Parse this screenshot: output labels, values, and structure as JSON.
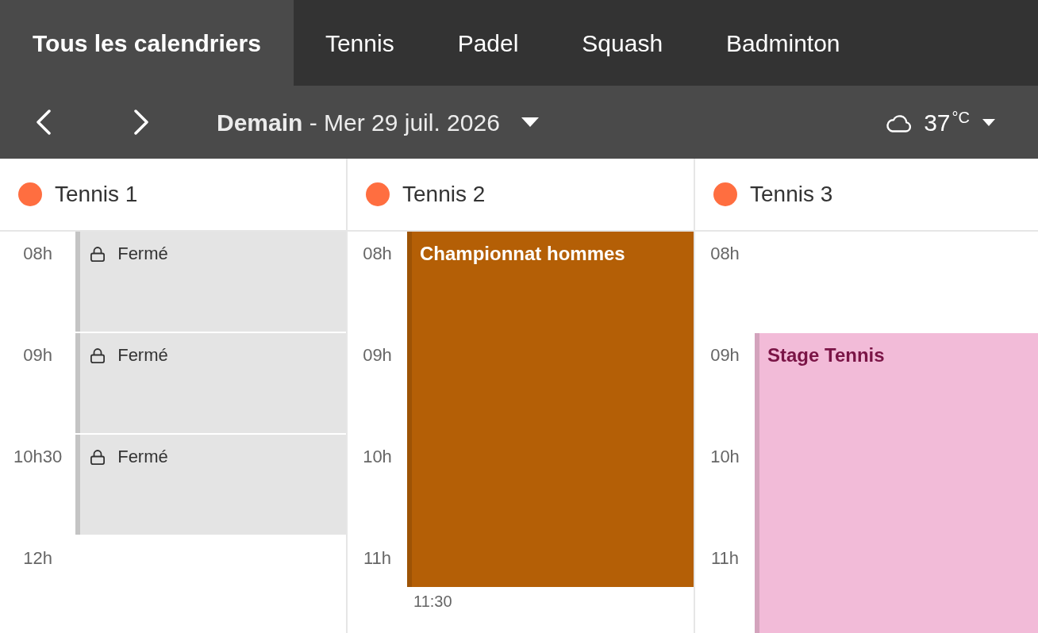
{
  "tabs": [
    {
      "label": "Tous les calendriers",
      "selected": true
    },
    {
      "label": "Tennis",
      "selected": false
    },
    {
      "label": "Padel",
      "selected": false
    },
    {
      "label": "Squash",
      "selected": false
    },
    {
      "label": "Badminton",
      "selected": false
    }
  ],
  "toolbar": {
    "date": "**Demain** - Mer 29 juil. 2026",
    "weather": {
      "temperature": "37$^{°C}$"
    }
  },
  "columns": [
    {
      "name": "Tennis 1",
      "color": "#ff6e40",
      "slots": [
        {
          "time": "08h",
          "kind": "closed",
          "label": "Fermé"
        },
        {
          "time": "09h",
          "kind": "closed",
          "label": "Fermé"
        },
        {
          "time": "10h30",
          "kind": "closed",
          "label": "Fermé"
        },
        {
          "time": "12h",
          "kind": "free"
        }
      ]
    },
    {
      "name": "Tennis 2",
      "color": "#ff6e40",
      "slots": [
        {
          "time": "08h",
          "kind": "start",
          "event": {
            "title": "Championnat hommes",
            "color": "#b45f06"
          }
        },
        {
          "time": "09h",
          "kind": "booked"
        },
        {
          "time": "10h",
          "kind": "booked"
        },
        {
          "time": "11h",
          "kind": "midway",
          "end_label": "11:30"
        }
      ]
    },
    {
      "name": "Tennis 3",
      "color": "#ff6e40",
      "slots": [
        {
          "time": "08h",
          "kind": "free"
        },
        {
          "time": "09h",
          "kind": "start",
          "event": {
            "title": "Stage Tennis",
            "color": "#f2bbd8"
          }
        },
        {
          "time": "10h",
          "kind": "booked"
        },
        {
          "time": "11h",
          "kind": "booked"
        }
      ]
    }
  ]
}
